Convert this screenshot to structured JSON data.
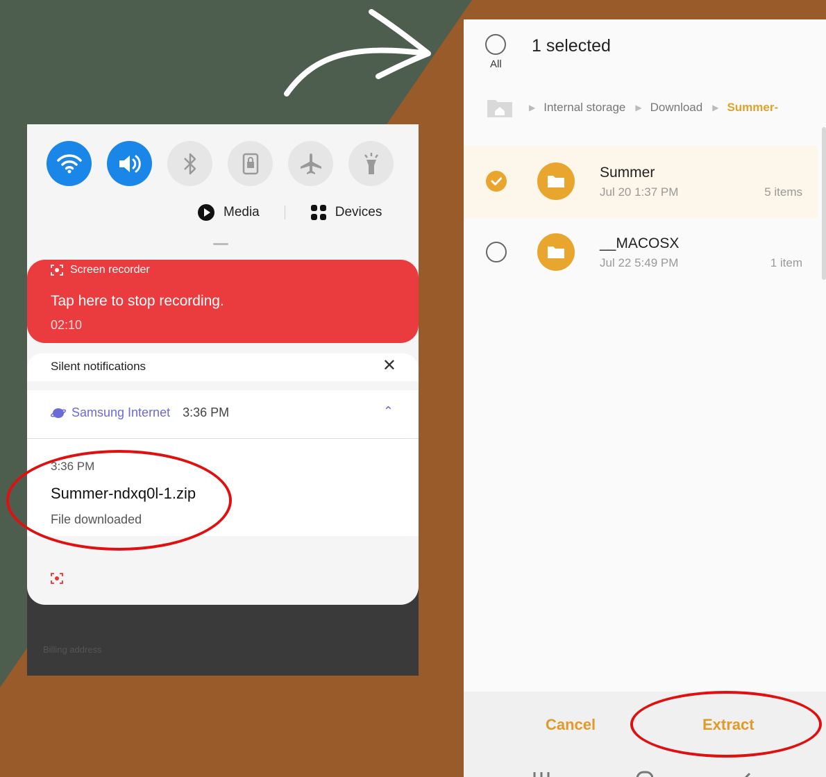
{
  "colors": {
    "bg_green": "#4e5e4e",
    "bg_brown": "#9a5b2b",
    "accent_blue": "#1a86e8",
    "recorder_red": "#ea3b3e",
    "accent_orange": "#e8a62e",
    "circle_red": "#e01010"
  },
  "left": {
    "quick_settings": {
      "icons": [
        "wifi-icon",
        "sound-icon",
        "bluetooth-icon",
        "screen-lock-icon",
        "airplane-mode-icon",
        "flashlight-icon"
      ],
      "media_label": "Media",
      "devices_label": "Devices"
    },
    "recorder": {
      "label": "Screen recorder",
      "title": "Tap here to stop recording.",
      "elapsed": "02:10"
    },
    "silent_notifications": {
      "label": "Silent notifications",
      "close": "✕"
    },
    "samsung_internet": {
      "app": "Samsung Internet",
      "time": "3:36 PM",
      "chevron": "⌃"
    },
    "download": {
      "time": "3:36 PM",
      "filename": "Summer-ndxq0l-1.zip",
      "status": "File downloaded"
    },
    "background_text": "Billing address"
  },
  "right": {
    "header": {
      "all_label": "All",
      "selected_label": "1 selected"
    },
    "breadcrumb": [
      "Internal storage",
      "Download",
      "Summer-"
    ],
    "items": [
      {
        "name": "Summer",
        "date": "Jul 20 1:37 PM",
        "count": "5 items",
        "selected": true
      },
      {
        "name": "__MACOSX",
        "date": "Jul 22 5:49 PM",
        "count": "1 item",
        "selected": false
      }
    ],
    "footer": {
      "cancel": "Cancel",
      "extract": "Extract"
    }
  }
}
